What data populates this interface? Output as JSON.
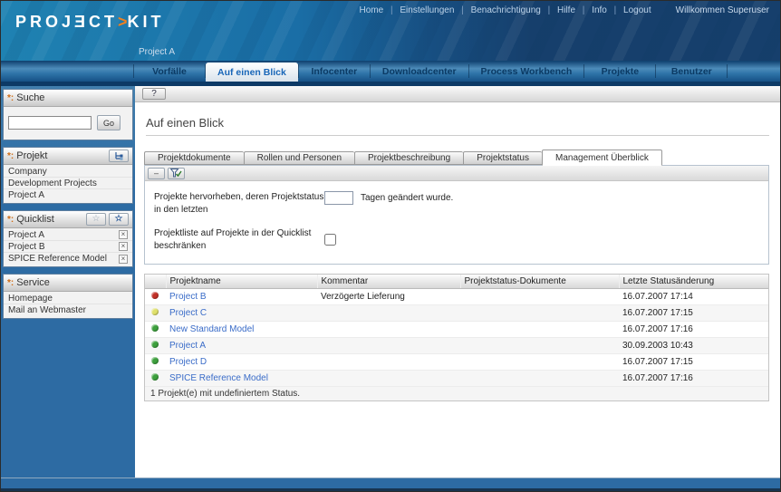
{
  "header": {
    "logo_left": "PROJƎCT",
    "logo_chevron": ">",
    "logo_right": "KIT",
    "nav": [
      "Home",
      "Einstellungen",
      "Benachrichtigung",
      "Hilfe",
      "Info",
      "Logout"
    ],
    "welcome": "Willkommen Superuser",
    "project_label": "Project A"
  },
  "main_nav": {
    "tabs": [
      {
        "label": "Vorfälle",
        "active": false
      },
      {
        "label": "Auf einen Blick",
        "active": true
      },
      {
        "label": "Infocenter",
        "active": false
      },
      {
        "label": "Downloadcenter",
        "active": false
      },
      {
        "label": "Process Workbench",
        "active": false
      },
      {
        "label": "Projekte",
        "active": false
      },
      {
        "label": "Benutzer",
        "active": false
      }
    ]
  },
  "sidebar": {
    "search": {
      "title": "Suche",
      "input_value": "",
      "go_label": "Go"
    },
    "project": {
      "title": "Projekt",
      "items": [
        "Company",
        "Development Projects",
        "Project A"
      ]
    },
    "quicklist": {
      "title": "Quicklist",
      "items": [
        "Project A",
        "Project B",
        "SPICE Reference Model"
      ]
    },
    "service": {
      "title": "Service",
      "items": [
        "Homepage",
        "Mail an Webmaster"
      ]
    }
  },
  "content": {
    "help_label": "?",
    "page_title": "Auf einen Blick",
    "tabs": [
      {
        "label": "Projektdokumente",
        "active": false
      },
      {
        "label": "Rollen und Personen",
        "active": false
      },
      {
        "label": "Projektbeschreibung",
        "active": false
      },
      {
        "label": "Projektstatus",
        "active": false
      },
      {
        "label": "Management Überblick",
        "active": true
      }
    ],
    "toolbar": {
      "minus_label": "–"
    },
    "filter": {
      "highlight_label": "Projekte hervorheben, deren Projektstatus in den letzten",
      "highlight_suffix": "Tagen geändert wurde.",
      "days_value": "",
      "quicklist_label": "Projektliste auf Projekte in der Quicklist beschränken",
      "quicklist_checked": false
    },
    "table": {
      "columns": [
        "",
        "Projektname",
        "Kommentar",
        "Projektstatus-Dokumente",
        "Letzte Statusänderung"
      ],
      "rows": [
        {
          "status": "red",
          "name": "Project B",
          "comment": "Verzögerte Lieferung",
          "docs": "",
          "changed": "16.07.2007 17:14"
        },
        {
          "status": "yellow",
          "name": "Project C",
          "comment": "",
          "docs": "",
          "changed": "16.07.2007 17:15"
        },
        {
          "status": "green",
          "name": "New Standard Model",
          "comment": "",
          "docs": "",
          "changed": "16.07.2007 17:16"
        },
        {
          "status": "green",
          "name": "Project A",
          "comment": "",
          "docs": "",
          "changed": "30.09.2003 10:43"
        },
        {
          "status": "green",
          "name": "Project D",
          "comment": "",
          "docs": "",
          "changed": "16.07.2007 17:15"
        },
        {
          "status": "green",
          "name": "SPICE Reference Model",
          "comment": "",
          "docs": "",
          "changed": "16.07.2007 17:16"
        }
      ],
      "footer": "1 Projekt(e) mit undefiniertem Status."
    }
  },
  "icons": {
    "panel_bullet": "*:",
    "star_outline": "☆",
    "close": "×",
    "hierarchy_tree": "tree-icon",
    "filter_funnel_check": "funnel-check-icon"
  },
  "colors": {
    "status_red": "#c23128",
    "status_yellow": "#dfe06a",
    "status_green": "#3da03d",
    "accent_orange": "#f08020",
    "link_blue": "#3a6cc8"
  }
}
